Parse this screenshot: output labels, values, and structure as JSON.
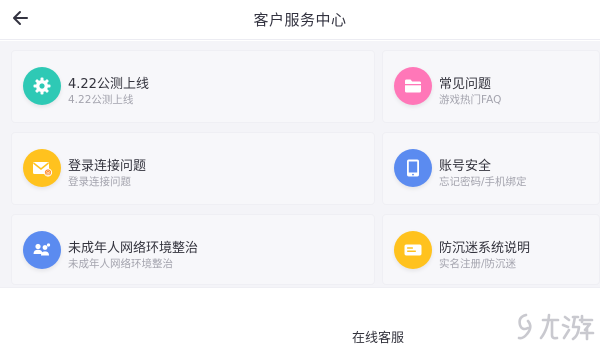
{
  "header": {
    "title": "客户服务中心",
    "back_icon": "arrow-left-icon"
  },
  "cards": [
    {
      "title": "4.22公测上线",
      "subtitle": "4.22公测上线",
      "icon": "gear-icon",
      "color": "#2ec9b5"
    },
    {
      "title": "常见问题",
      "subtitle": "游戏热门FAQ",
      "icon": "folder-icon",
      "color": "#ff77b8"
    },
    {
      "title": "登录连接问题",
      "subtitle": "登录连接问题",
      "icon": "mail-icon",
      "color": "#ffc21e"
    },
    {
      "title": "账号安全",
      "subtitle": "忘记密码/手机绑定",
      "icon": "tablet-icon",
      "color": "#5b8bf0"
    },
    {
      "title": "未成年人网络环境整治",
      "subtitle": "未成年人网络环境整治",
      "icon": "people-icon",
      "color": "#5b8bf0"
    },
    {
      "title": "防沉迷系统说明",
      "subtitle": "实名注册/防沉迷",
      "icon": "id-card-icon",
      "color": "#ffc21e"
    }
  ],
  "footer": {
    "online_service_label": "在线客服"
  },
  "watermark": {
    "logo": "jiuyou-logo"
  }
}
